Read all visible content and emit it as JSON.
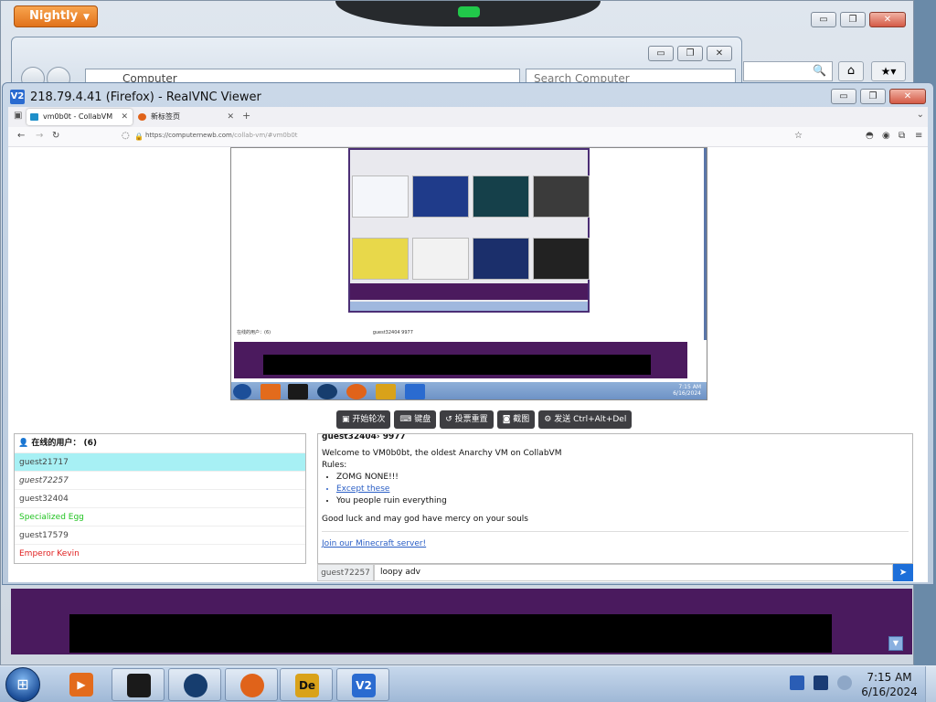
{
  "outer_firefox": {
    "menu_button": "Nightly",
    "minimize": "▭",
    "restore": "❐",
    "close": "✕"
  },
  "explorer": {
    "address": "Computer",
    "search_placeholder": "Search Computer"
  },
  "vnc": {
    "title": "218.79.4.41 (Firefox) - RealVNC Viewer",
    "logo": "V2"
  },
  "inner_firefox": {
    "tabs": [
      {
        "label": "vm0b0t - CollabVM"
      },
      {
        "label": "新标签页"
      }
    ],
    "url_host": "https://computernewb.com",
    "url_path": "/collab-vm/#vm0b0t"
  },
  "vm_toolbar": [
    {
      "icon": "vote-icon",
      "label": "开始轮次"
    },
    {
      "icon": "keyboard-icon",
      "label": "键盘"
    },
    {
      "icon": "reset-icon",
      "label": "投票重置"
    },
    {
      "icon": "camera-icon",
      "label": "截图"
    },
    {
      "icon": "gear-icon",
      "label": "发送 Ctrl+Alt+Del"
    }
  ],
  "vm_inner": {
    "online_users": "在线的用户：(6)",
    "chat_head": "guest32404 9977",
    "clock_time": "7:15 AM",
    "clock_date": "6/16/2024"
  },
  "users": {
    "header": "在线的用户：",
    "count": "(6)",
    "list": [
      {
        "name": "guest21717",
        "color": "#444444"
      },
      {
        "name": "guest72257",
        "color": "#444444"
      },
      {
        "name": "guest32404",
        "color": "#444444"
      },
      {
        "name": "Specialized Egg",
        "color": "#22c322"
      },
      {
        "name": "guest17579",
        "color": "#444444"
      },
      {
        "name": "Emperor Kevin",
        "color": "#e02020"
      }
    ]
  },
  "chat": {
    "header": "guest32404› 9977",
    "welcome": "Welcome to VM0b0bt, the oldest Anarchy VM on CollabVM",
    "rules_label": "Rules:",
    "rules": [
      "ZOMG NONE!!!",
      "Except these",
      "You people ruin everything"
    ],
    "farewell": "Good luck and may god have mercy on your souls",
    "link": "Join our Minecraft server!",
    "username": "guest72257",
    "input_value": "loopy adv",
    "send": "➤"
  },
  "taskbar": {
    "time": "7:15 AM",
    "date": "6/16/2024",
    "items": [
      {
        "name": "media-player-icon",
        "color": "#e36b1c"
      },
      {
        "name": "app-black-icon",
        "color": "#1a1a1a"
      },
      {
        "name": "globe-icon",
        "color": "#163d6e"
      },
      {
        "name": "firefox-icon",
        "color": "#e0631a"
      },
      {
        "name": "de-app-icon",
        "color": "#d9a21a"
      },
      {
        "name": "vnc-icon",
        "color": "#2a6bd0"
      }
    ]
  },
  "colors": {
    "accent_blue": "#1d6fd9",
    "vm_purple": "#4a1a5e",
    "highlight_row": "#a7f0f4"
  }
}
